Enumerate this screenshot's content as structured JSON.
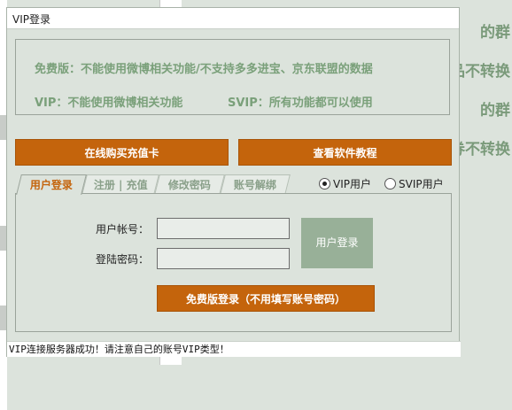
{
  "background": {
    "right_texts": [
      "的群",
      "品不转换",
      "的群",
      "券不转换"
    ]
  },
  "dialog": {
    "title": "VIP登录",
    "info": {
      "line1": "免费版：不能使用微博相关功能/不支持多多进宝、京东联盟的数据",
      "line2_vip": "VIP：不能使用微博相关功能",
      "line2_svip": "SVIP：所有功能都可以使用"
    },
    "buttons": {
      "buy_card": "在线购买充值卡",
      "tutorial": "查看软件教程"
    },
    "tabs": [
      {
        "label": "用户登录",
        "active": true
      },
      {
        "label": "注册 | 充值",
        "active": false
      },
      {
        "label": "修改密码",
        "active": false
      },
      {
        "label": "账号解绑",
        "active": false
      }
    ],
    "radios": [
      {
        "label": "VIP用户",
        "checked": true
      },
      {
        "label": "SVIP用户",
        "checked": false
      }
    ],
    "form": {
      "account_label": "用户帐号：",
      "account_value": "",
      "password_label": "登陆密码：",
      "password_value": "",
      "login_button": "用户登录",
      "free_login_button": "免费版登录（不用填写账号密码）"
    },
    "status": "VIP连接服务器成功！请注意自己的账号VIP类型！"
  },
  "colors": {
    "accent": "#c4640c",
    "info_text": "#7aa07a",
    "login_button": "#98b098",
    "panel_bg": "#dce3dc"
  }
}
